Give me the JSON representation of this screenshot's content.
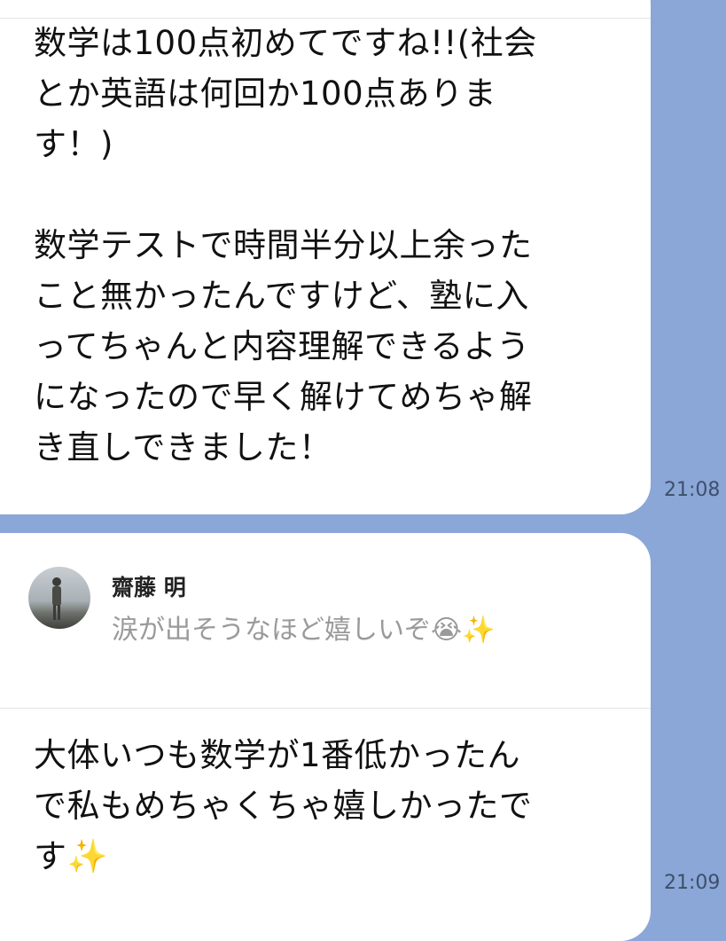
{
  "messages": [
    {
      "text": "数学は100点初めてですね!!(社会\nとか英語は何回か100点ありま\nす！)\n\n数学テストで時間半分以上余った\nこと無かったんですけど、塾に入\nってちゃんと内容理解できるよう\nになったので早く解けてめちゃ解\nき直しできました！",
      "time": "21:08"
    },
    {
      "reply_to": {
        "name": "齋藤 明",
        "quote": "涙が出そうなほど嬉しいぞ😭✨"
      },
      "text": "大体いつも数学が1番低かったん\nで私もめちゃくちゃ嬉しかったで\nす✨",
      "time": "21:09"
    }
  ],
  "colors": {
    "chat_background": "#8aa7d8",
    "bubble": "#ffffff",
    "text": "#111111",
    "quote_text": "#9a9a9a"
  },
  "icons": {
    "avatar": "user-avatar-photo"
  }
}
